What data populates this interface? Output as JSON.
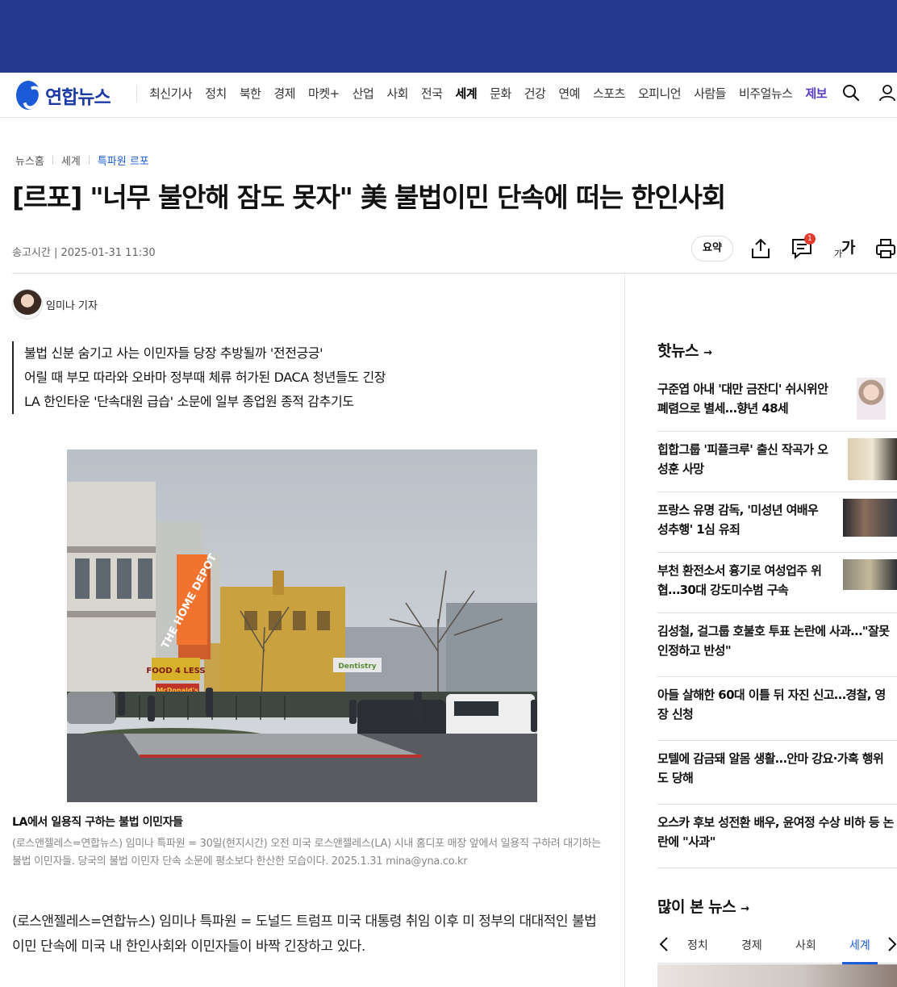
{
  "header": {
    "logo_text": "연합뉴스",
    "menu": [
      "최신기사",
      "정치",
      "북한",
      "경제",
      "마켓+",
      "산업",
      "사회",
      "전국",
      "세계",
      "문화",
      "건강",
      "연예",
      "스포츠",
      "오피니언",
      "사람들",
      "비주얼뉴스",
      "제보"
    ],
    "active_menu": "세계",
    "icons": [
      "search-icon",
      "user-icon"
    ]
  },
  "breadcrumb": [
    "뉴스홈",
    "세계",
    "특파원 르포"
  ],
  "article": {
    "headline": "[르포] \"너무 불안해 잠도 못자\" 美 불법이민 단속에 떠는 한인사회",
    "published": "송고시간 | 2025-01-31 11:30",
    "tools": {
      "summary_label": "요약",
      "comment_count": "1",
      "font_size_label_big": "가",
      "font_size_label_small": "가"
    },
    "reporter": "임미나 기자",
    "summary_lines": [
      "불법 신분 숨기고 사는 이민자들 당장 추방될까 '전전긍긍'",
      "어릴 때 부모 따라와 오바마 정부때 체류 허가된 DACA 청년들도 긴장",
      "LA 한인타운 '단속대원 급습' 소문에 일부 종업원 종적 감추기도"
    ],
    "photo_signs": {
      "store": "THE HOME DEPOT",
      "food": "FOOD 4 LESS",
      "fast_food": "McDonald's",
      "dentist": "Dentistry"
    },
    "photo_caption": "LA에서 일용직 구하는 불법 이민자들",
    "photo_description": "(로스앤젤레스=연합뉴스) 임미나 특파원 = 30일(현지시간) 오전 미국 로스앤젤레스(LA) 시내 홈디포 매장 앞에서 일용직 구하려 대기하는 불법 이민자들. 당국의 불법 이민자 단속 소문에 평소보다 한산한 모습이다. 2025.1.31 mina@yna.co.kr",
    "body": "(로스앤젤레스=연합뉴스) 임미나 특파원 = 도널드 트럼프 미국 대통령 취임 이후 미 정부의 대대적인 불법이민 단속에 미국 내 한인사회와 이민자들이 바짝 긴장하고 있다."
  },
  "hot_news": {
    "title": "핫뉴스",
    "arrow": "→",
    "items": [
      {
        "line1": "구준엽 아내 '대만 금잔디' 쉬시위안",
        "line2": "폐렴으로 별세…향년 48세"
      },
      {
        "line1": "힙합그룹 '피플크루' 출신 작곡가 오",
        "line2": "성훈 사망"
      },
      {
        "line1": "프랑스 유명 감독, '미성년 여배우",
        "line2": "성추행' 1심 유죄"
      },
      {
        "line1": "부천 환전소서 흉기로 여성업주 위",
        "line2": "협…30대 강도미수범 구속"
      },
      {
        "line1": "김성철, 걸그룹 호불호 투표 논란에 사과…\"잘못",
        "line2": "인정하고 반성\""
      },
      {
        "line1": "아들 살해한 60대 이틀 뒤 자진 신고…경찰, 영",
        "line2": "장 신청"
      },
      {
        "line1": "모텔에 감금돼 알몸 생활…안마 강요·가혹 행위",
        "line2": "도 당해"
      },
      {
        "line1": "오스카 후보 성전환 배우, 윤여정 수상 비하 등 논",
        "line2": "란에 \"사과\""
      }
    ]
  },
  "most_viewed": {
    "title": "많이 본 뉴스",
    "arrow": "→",
    "tabs": [
      "정치",
      "경제",
      "사회",
      "세계"
    ],
    "active_tab": "세계"
  }
}
